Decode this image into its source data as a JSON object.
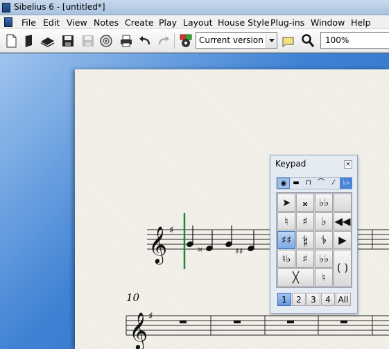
{
  "window": {
    "title": "Sibelius 6 - [untitled*]"
  },
  "menu": [
    "File",
    "Edit",
    "View",
    "Notes",
    "Create",
    "Play",
    "Layout",
    "House Style",
    "Plug-ins",
    "Window",
    "Help"
  ],
  "toolbar": {
    "version_selected": "Current version",
    "zoom": "100%",
    "icons": [
      "new-document-icon",
      "open-icon",
      "open-icon-2",
      "save-icon",
      "save-disabled-icon",
      "cd-icon",
      "print-icon",
      "undo-icon",
      "redo-icon",
      "plugin-gear-icon",
      "comment-icon",
      "magnifier-icon"
    ]
  },
  "score": {
    "measure_number": "10"
  },
  "keypad": {
    "title": "Keypad",
    "close_label": "×",
    "tabs": [
      "◉",
      "▬",
      "⊓",
      "⌒",
      "⁄",
      "♭♭"
    ],
    "layouts": [
      "1",
      "2",
      "3",
      "4",
      "All"
    ]
  }
}
